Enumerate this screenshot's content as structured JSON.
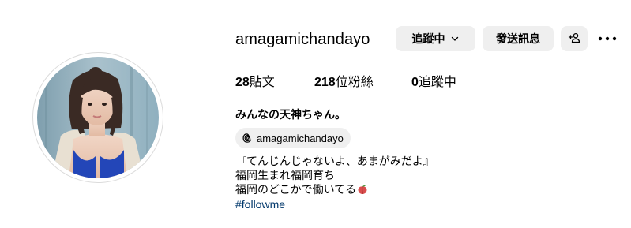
{
  "profile": {
    "username": "amagamichandayo",
    "full_name": "みんなの天神ちゃん。",
    "avatar_icon": "profile-photo"
  },
  "actions": {
    "following_label": "追蹤中",
    "message_label": "發送訊息",
    "suggest_icon": "add-person-icon",
    "more_icon": "more-options-icon"
  },
  "stats": {
    "posts_count": "28",
    "posts_label": "貼文",
    "followers_count": "218",
    "followers_label": "位粉絲",
    "following_count": "0",
    "following_label": "追蹤中"
  },
  "threads": {
    "handle": "amagamichandayo",
    "icon": "threads-icon"
  },
  "bio": {
    "line1": "『てんじんじゃないよ、あまがみだよ』",
    "line2": "福岡生まれ福岡育ち",
    "line3": "福岡のどこかで働いてる",
    "line3_emoji": "peach-icon",
    "hashtag": "#followme"
  },
  "colors": {
    "button_bg": "#efefef",
    "hashtag": "#00376b",
    "border": "#dbdbdb"
  }
}
